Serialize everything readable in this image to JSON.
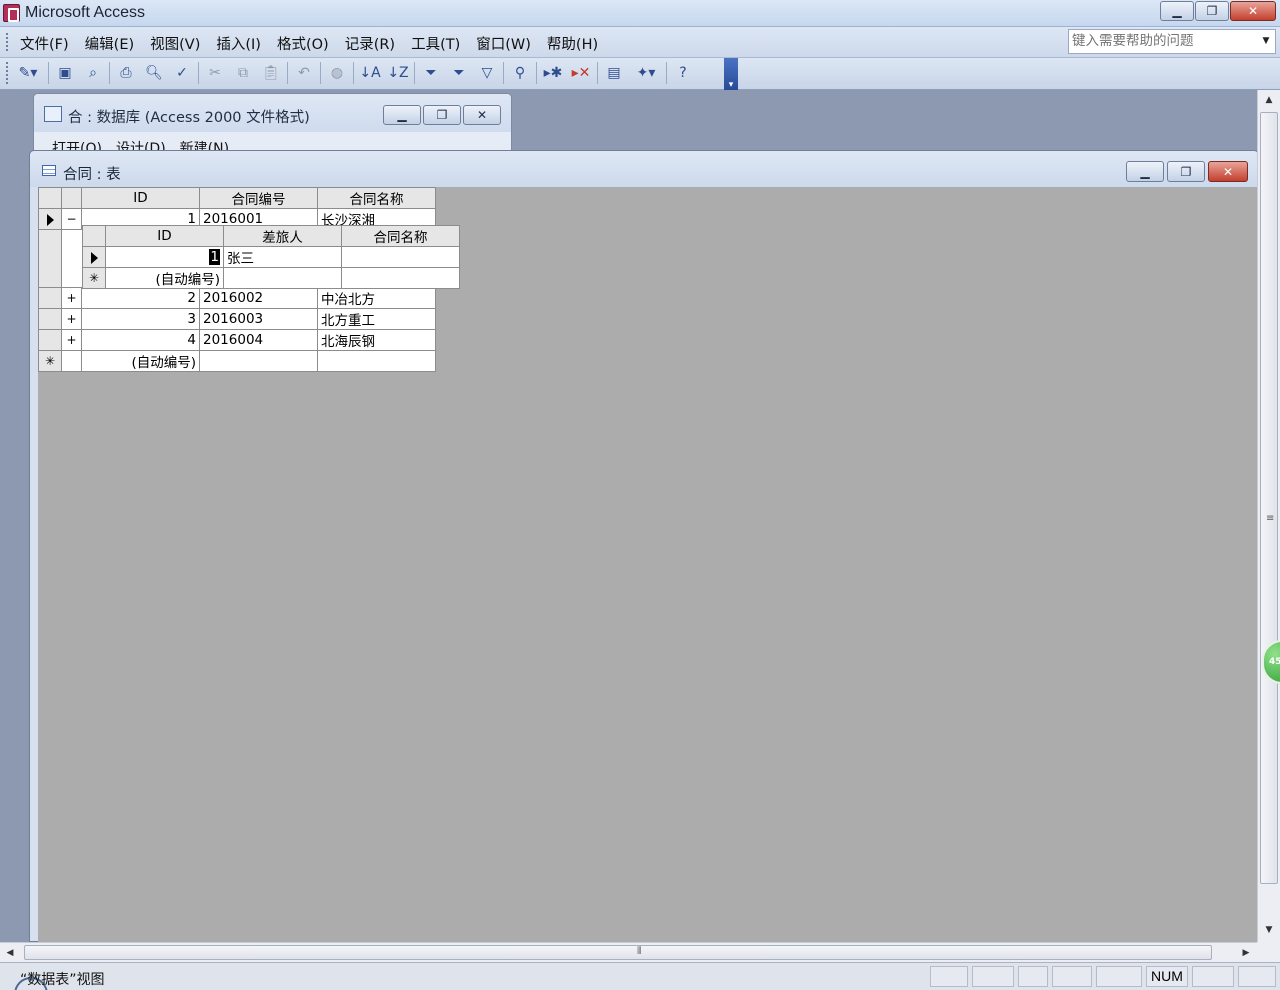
{
  "app": {
    "title": "Microsoft Access"
  },
  "menu": [
    "文件(F)",
    "编辑(E)",
    "视图(V)",
    "插入(I)",
    "格式(O)",
    "记录(R)",
    "工具(T)",
    "窗口(W)",
    "帮助(H)"
  ],
  "help_box": {
    "placeholder": "键入需要帮助的问题"
  },
  "db_window": {
    "title": "合 : 数据库 (Access 2000 文件格式)",
    "toolbar": [
      "打开(O)",
      "设计(D)",
      "新建(N)"
    ]
  },
  "table_window": {
    "title": "合同 : 表"
  },
  "main_table": {
    "headers": [
      "ID",
      "合同编号",
      "合同名称"
    ],
    "rows": [
      {
        "marker": "−",
        "id": "1",
        "code": "2016001",
        "name": "长沙深湘"
      },
      {
        "marker": "+",
        "id": "2",
        "code": "2016002",
        "name": "中冶北方"
      },
      {
        "marker": "+",
        "id": "3",
        "code": "2016003",
        "name": "北方重工"
      },
      {
        "marker": "+",
        "id": "4",
        "code": "2016004",
        "name": "北海辰钢"
      }
    ],
    "new_row": {
      "id": "(自动编号)"
    }
  },
  "sub_table": {
    "headers": [
      "ID",
      "差旅人",
      "合同名称"
    ],
    "rows": [
      {
        "id": "1",
        "traveler": "张三",
        "name": ""
      }
    ],
    "new_row": {
      "id": "(自动编号)"
    }
  },
  "badge": "45",
  "status": {
    "text": "“数据表”视图",
    "num": "NUM"
  }
}
